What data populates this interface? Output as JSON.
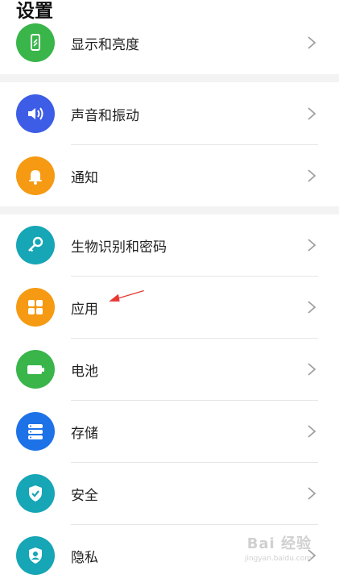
{
  "page": {
    "title": "设置"
  },
  "items": [
    {
      "label": "显示和亮度",
      "icon": "display-icon",
      "color": "#39b54a"
    },
    {
      "label": "声音和振动",
      "icon": "speaker-icon",
      "color": "#3d5de6"
    },
    {
      "label": "通知",
      "icon": "bell-icon",
      "color": "#f59a12"
    },
    {
      "label": "生物识别和密码",
      "icon": "key-icon",
      "color": "#16a6b6"
    },
    {
      "label": "应用",
      "icon": "apps-icon",
      "color": "#f59a12"
    },
    {
      "label": "电池",
      "icon": "battery-icon",
      "color": "#39b54a"
    },
    {
      "label": "存储",
      "icon": "storage-icon",
      "color": "#1e72e8"
    },
    {
      "label": "安全",
      "icon": "shield-icon",
      "color": "#16a6b6"
    },
    {
      "label": "隐私",
      "icon": "privacy-icon",
      "color": "#16a6b6"
    }
  ],
  "watermark": {
    "text": "Bai 经验",
    "sub": "jingyan.baidu.com"
  }
}
